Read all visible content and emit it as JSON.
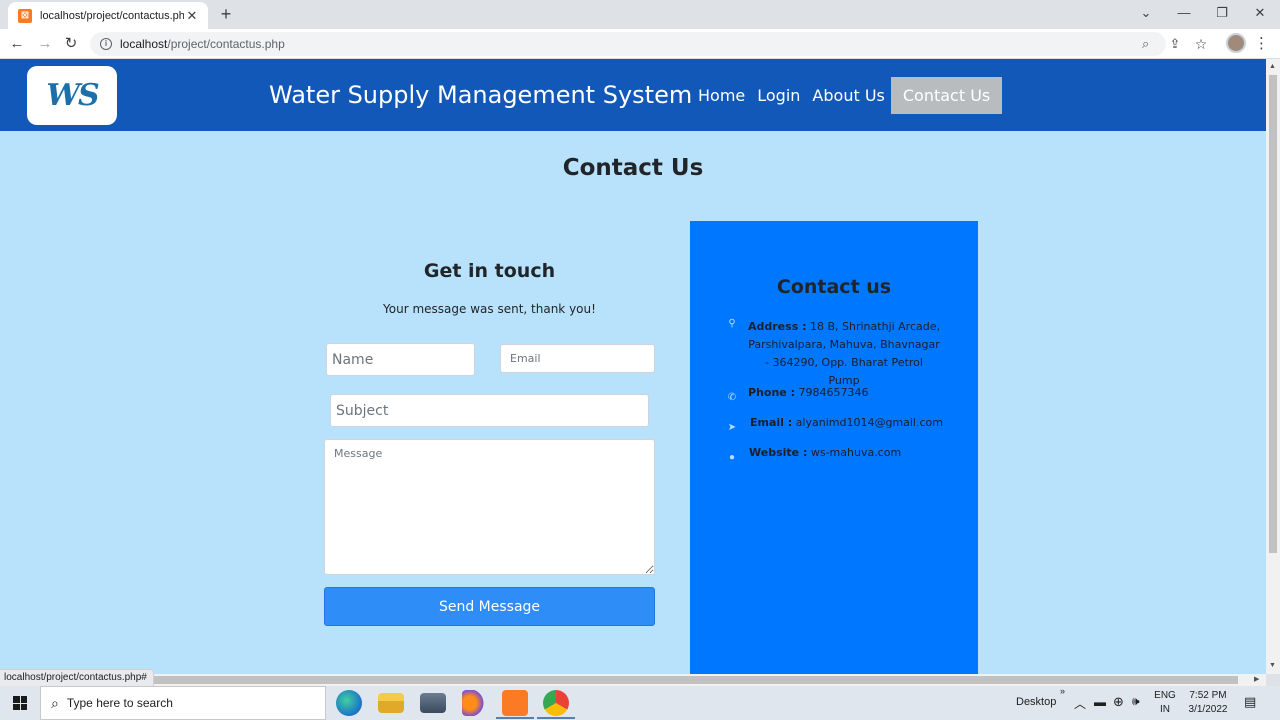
{
  "browser": {
    "tab_title": "localhost/project/contactus.php",
    "url_host": "localhost",
    "url_path": "/project/contactus.php",
    "status_url": "localhost/project/contactus.php#"
  },
  "site": {
    "logo_text": "WS",
    "title": "Water Supply Management System",
    "nav": [
      {
        "label": "Home"
      },
      {
        "label": "Login"
      },
      {
        "label": "About Us"
      },
      {
        "label": "Contact Us",
        "active": true
      }
    ]
  },
  "page": {
    "title": "Contact Us"
  },
  "form": {
    "heading": "Get in touch",
    "sent_message": "Your message was sent, thank you!",
    "name_placeholder": "Name",
    "email_placeholder": "Email",
    "subject_placeholder": "Subject",
    "message_placeholder": "Message",
    "submit_label": "Send Message"
  },
  "contact": {
    "heading": "Contact us",
    "address_label": "Address :",
    "address_value": "18 B, Shrinathji Arcade, Parshivalpara, Mahuva, Bhavnagar - 364290, Opp. Bharat Petrol Pump",
    "phone_label": "Phone :",
    "phone_value": "7984657346",
    "email_label": "Email :",
    "email_value": "alyanimd1014@gmail.com",
    "website_label": "Website :",
    "website_value": "ws-mahuva.com"
  },
  "taskbar": {
    "search_placeholder": "Type here to search",
    "desktop_label": "Desktop",
    "lang_top": "ENG",
    "lang_bottom": "IN",
    "time": "7:52 PM",
    "date": "3/1/2022"
  },
  "colors": {
    "header_bg": "#1258b8",
    "page_bg": "#b8e2fb",
    "panel_bg": "#0077ff",
    "button_bg": "#2f8df7"
  }
}
